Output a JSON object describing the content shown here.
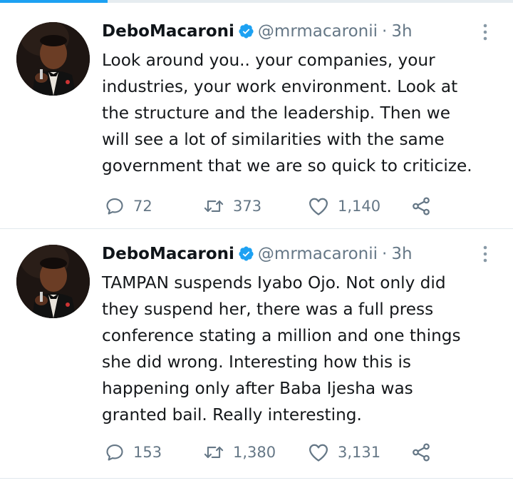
{
  "progress": {
    "fraction": 0.21,
    "color": "#1da1f2"
  },
  "colors": {
    "text": "#14171a",
    "muted": "#657786",
    "verified": "#1da1f2",
    "divider": "#e1e8ed"
  },
  "tweets": [
    {
      "author_name": "DeboMacaroni",
      "handle": "@mrmacaronii",
      "separator": "·",
      "time": "3h",
      "text": "Look around you.. your companies, your\nindustries, your work environment. Look at\nthe structure and the leadership. Then we\nwill see a lot of similarities with the same\ngovernment that we are so quick to criticize.",
      "reply_count": "72",
      "retweet_count": "373",
      "like_count": "1,140",
      "icons": {
        "verified": "verified-badge-icon",
        "more": "more-vertical-icon",
        "reply": "reply-icon",
        "retweet": "retweet-icon",
        "like": "heart-icon",
        "share": "share-icon"
      }
    },
    {
      "author_name": "DeboMacaroni",
      "handle": "@mrmacaronii",
      "separator": "·",
      "time": "3h",
      "text": "TAMPAN suspends Iyabo Ojo. Not only did\nthey suspend her, there was a full press\nconference stating a million and one things\nshe did wrong. Interesting how this is\nhappening only after Baba Ijesha was\ngranted bail. Really interesting.",
      "reply_count": "153",
      "retweet_count": "1,380",
      "like_count": "3,131",
      "icons": {
        "verified": "verified-badge-icon",
        "more": "more-vertical-icon",
        "reply": "reply-icon",
        "retweet": "retweet-icon",
        "like": "heart-icon",
        "share": "share-icon"
      }
    }
  ]
}
